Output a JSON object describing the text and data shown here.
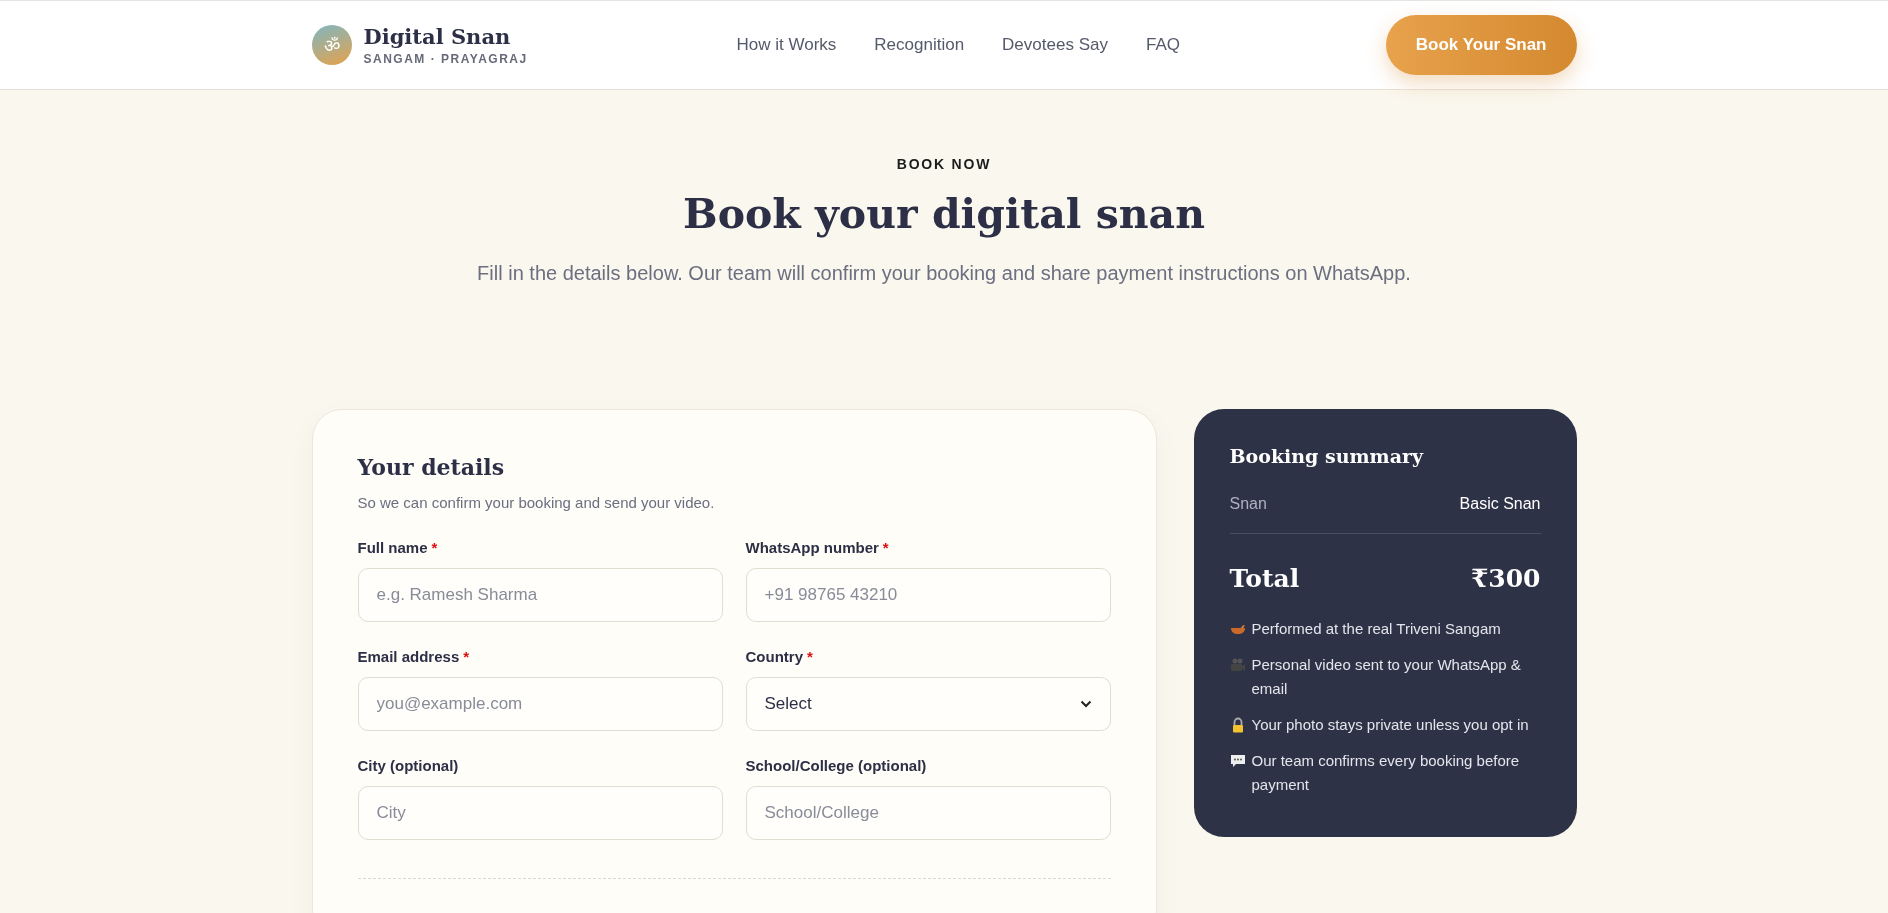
{
  "header": {
    "logo_glyph": "ॐ",
    "brand": "Digital Snan",
    "tagline": "SANGAM · PRAYAGRAJ",
    "nav": [
      {
        "label": "How it Works"
      },
      {
        "label": "Recognition"
      },
      {
        "label": "Devotees Say"
      },
      {
        "label": "FAQ"
      }
    ],
    "cta": "Book Your Snan"
  },
  "hero": {
    "eyebrow": "BOOK NOW",
    "title": "Book your digital snan",
    "subtitle": "Fill in the details below. Our team will confirm your booking and share payment instructions on WhatsApp."
  },
  "form": {
    "title": "Your details",
    "subtitle": "So we can confirm your booking and send your video.",
    "fields": [
      {
        "kind": "input",
        "label": "Full name",
        "required_mark": "*",
        "placeholder": "e.g. Ramesh Sharma"
      },
      {
        "kind": "input",
        "label": "WhatsApp number",
        "required_mark": "*",
        "placeholder": "+91 98765 43210"
      },
      {
        "kind": "input",
        "label": "Email address",
        "required_mark": "*",
        "placeholder": "you@example.com"
      },
      {
        "kind": "select",
        "label": "Country",
        "required_mark": "*",
        "value": "Select"
      },
      {
        "kind": "input",
        "label": "City (optional)",
        "placeholder": "City"
      },
      {
        "kind": "input",
        "label": "School/College (optional)",
        "placeholder": "School/College"
      }
    ]
  },
  "summary": {
    "title": "Booking summary",
    "rows": [
      {
        "label": "Snan",
        "value": "Basic Snan"
      }
    ],
    "total_label": "Total",
    "total_value": "₹300",
    "points": [
      {
        "text": "Performed at the real Triveni Sangam"
      },
      {
        "text": "Personal video sent to your WhatsApp & email"
      },
      {
        "text": "Your photo stays private unless you opt in"
      },
      {
        "text": "Our team confirms every booking before payment"
      }
    ]
  }
}
